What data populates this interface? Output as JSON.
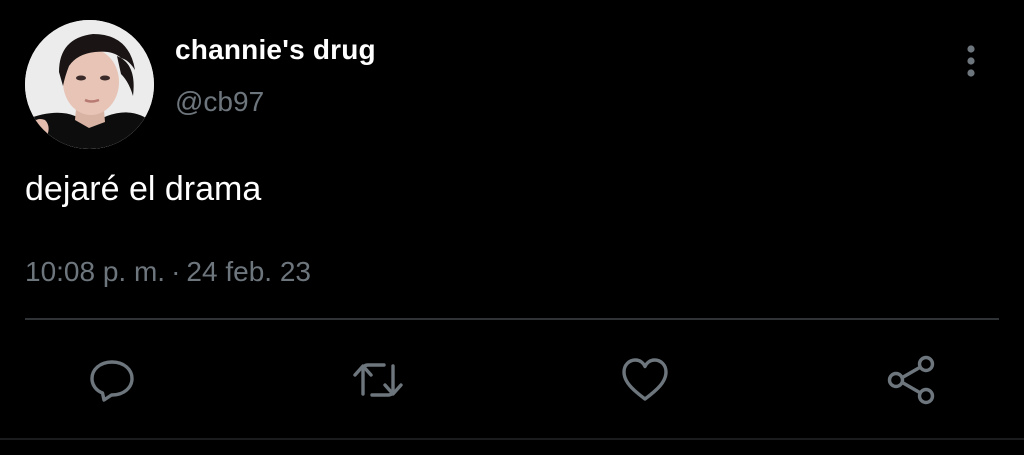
{
  "user": {
    "display_name": "channie's drug",
    "handle": "@cb97",
    "avatar": "profile-photo"
  },
  "tweet": {
    "text": "dejaré el drama",
    "time": "10:08 p. m.",
    "separator": "·",
    "date": "24 feb. 23"
  },
  "actions": [
    {
      "name": "reply",
      "icon": "comment-bubble-icon"
    },
    {
      "name": "retweet",
      "icon": "retweet-arrows-icon"
    },
    {
      "name": "like",
      "icon": "heart-icon"
    },
    {
      "name": "share",
      "icon": "share-nodes-icon"
    }
  ],
  "menu": {
    "icon": "vertical-ellipsis-icon"
  },
  "colors": {
    "background": "#000000",
    "primary_text": "#ffffff",
    "secondary_text": "#6e767d",
    "icon": "#6e767d",
    "divider": "#2f3336"
  }
}
